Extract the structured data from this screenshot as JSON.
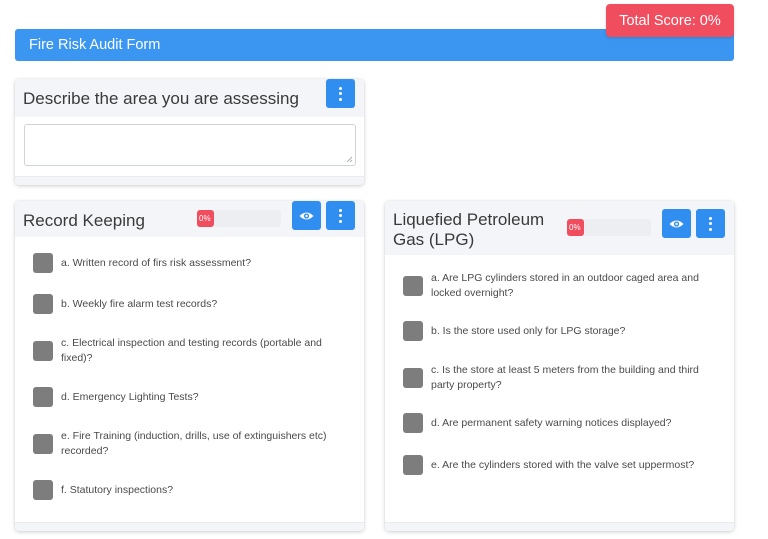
{
  "header": {
    "title": "Fire Risk Audit Form",
    "total_score": "Total Score: 0%"
  },
  "colors": {
    "header": "#3a96f0",
    "button": "#2f8ef0",
    "score": "#f04d5f",
    "checkbox": "#7d7d7d"
  },
  "area_card": {
    "title": "Describe the area you are assessing",
    "input_value": ""
  },
  "record_keeping": {
    "title": "Record Keeping",
    "progress": 0,
    "progress_label": "0%",
    "questions": [
      "a. Written record of firs risk assessment?",
      "b. Weekly fire alarm test records?",
      "c. Electrical inspection and testing records (portable and fixed)?",
      "d. Emergency Lighting Tests?",
      "e. Fire Training (induction, drills, use of extinguishers etc) recorded?",
      "f. Statutory inspections?"
    ]
  },
  "lpg": {
    "title": "Liquefied Petroleum Gas (LPG)",
    "progress": 0,
    "progress_label": "0%",
    "questions": [
      "a. Are LPG cylinders stored in an outdoor caged area and locked overnight?",
      "b. Is the store used only for LPG storage?",
      "c. Is the store at least 5 meters from the building and third party property?",
      "d. Are permanent safety warning notices displayed?",
      "e. Are the cylinders stored with the valve set uppermost?"
    ]
  },
  "icons": {
    "menu": "kebab-menu-icon",
    "view": "eye-icon"
  }
}
